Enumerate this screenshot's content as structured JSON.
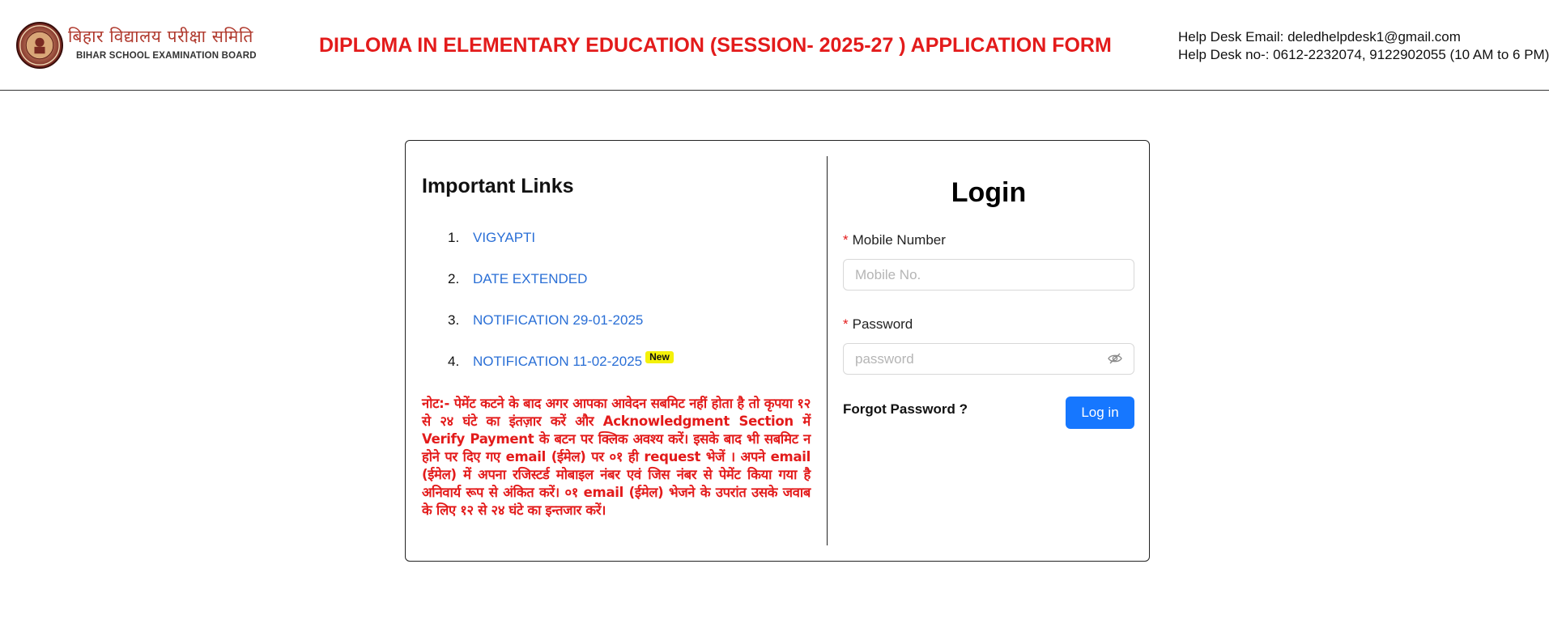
{
  "header": {
    "org_name_hindi": "बिहार विद्यालय परीक्षा समिति",
    "org_name_english": "BIHAR SCHOOL EXAMINATION BOARD",
    "form_title": "DIPLOMA IN ELEMENTARY EDUCATION (SESSION- 2025-27 ) APPLICATION FORM",
    "helpdesk_email": "Help Desk Email: deledhelpdesk1@gmail.com",
    "helpdesk_phone": "Help Desk no-: 0612-2232074, 9122902055 (10 AM to 6 PM)"
  },
  "important_links": {
    "title": "Important Links",
    "items": [
      {
        "number": "1.",
        "label": "VIGYAPTI"
      },
      {
        "number": "2.",
        "label": "DATE EXTENDED"
      },
      {
        "number": "3.",
        "label": "NOTIFICATION 29-01-2025"
      },
      {
        "number": "4.",
        "label": "NOTIFICATION 11-02-2025",
        "badge": "New"
      }
    ],
    "note": "नोट:- पेमेंट कटने के बाद अगर आपका आवेदन सबमिट नहीं होता है तो कृपया १२ से २४ घंटे का इंतज़ार करें और Acknowledgment Section में Verify Payment के बटन पर क्लिक अवश्य करें। इसके बाद भी सबमिट न होने पर दिए गए email (ईमेल) पर ०१ ही request भेजें । अपने email (ईमेल) में अपना रजिस्टर्ड मोबाइल नंबर एवं जिस नंबर से पेमेंट किया गया है अनिवार्य रूप से अंकित करें। ०१ email (ईमेल) भेजने के उपरांत उसके जवाब के लिए १२ से २४ घंटे का इन्तजार करें।"
  },
  "login": {
    "title": "Login",
    "mobile_label": "Mobile Number",
    "mobile_placeholder": "Mobile No.",
    "mobile_value": "",
    "password_label": "Password",
    "password_placeholder": "password",
    "password_value": "",
    "required_mark": "*",
    "forgot_label": "Forgot Password ?",
    "submit_label": "Log in",
    "accent_color": "#1677ff"
  },
  "icons": {
    "logo": "bseb-emblem-icon",
    "password_toggle": "eye-off-icon"
  },
  "colors": {
    "title_red": "#e31b1b",
    "link_blue": "#2a6fd6",
    "badge_yellow": "#f4f10a"
  }
}
